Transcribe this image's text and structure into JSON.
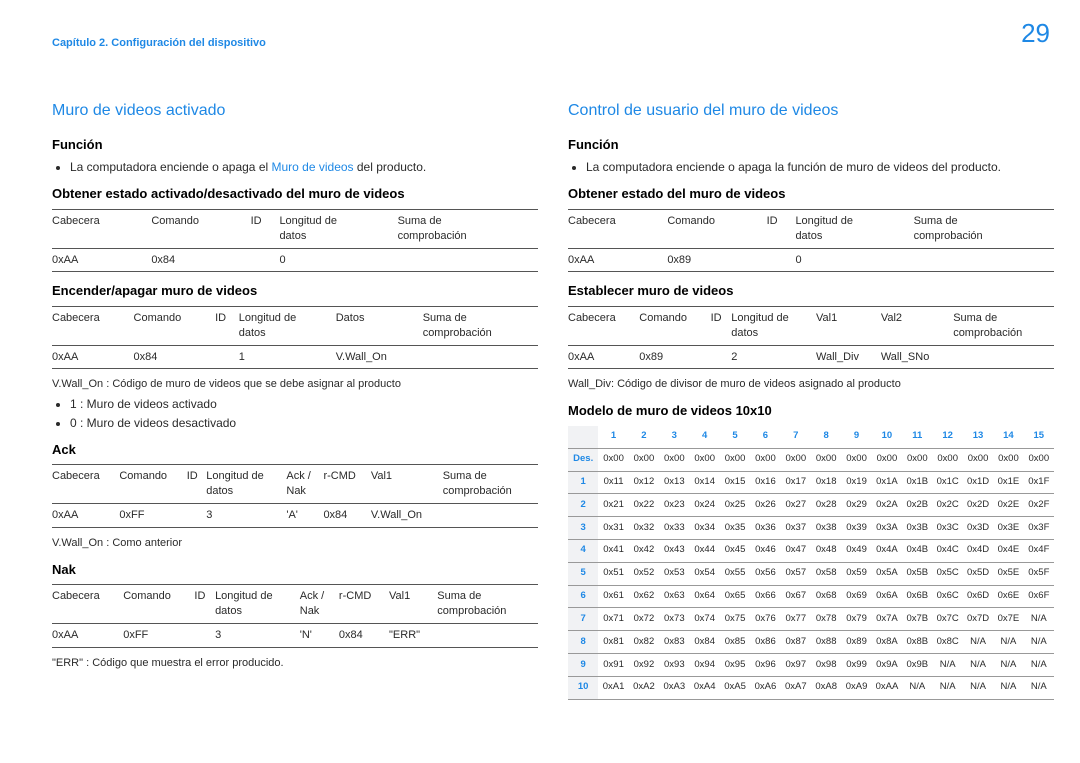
{
  "breadcrumb": "Capítulo 2. Configuración del dispositivo",
  "page_number": "29",
  "left": {
    "h_blue": "Muro de videos activado",
    "h_funcion": "Función",
    "funcion_bullet_pre": "La computadora enciende o apaga el ",
    "funcion_bullet_link": "Muro de videos",
    "funcion_bullet_post": " del producto.",
    "h_get": "Obtener estado activado/desactivado del muro de videos",
    "tbl_simple_cols": [
      "Cabecera",
      "Comando",
      "ID",
      "Longitud de datos",
      "Suma de comprobación"
    ],
    "tbl_get_row": [
      "0xAA",
      "0x84",
      "",
      "0",
      ""
    ],
    "h_set": "Encender/apagar muro de videos",
    "tbl_set_cols": [
      "Cabecera",
      "Comando",
      "ID",
      "Longitud de datos",
      "Datos",
      "Suma de comprobación"
    ],
    "tbl_set_row": [
      "0xAA",
      "0x84",
      "",
      "1",
      "V.Wall_On",
      ""
    ],
    "note_vwallon": "V.Wall_On : Código de muro de videos que se debe asignar al producto",
    "note_1": "1 : Muro de videos activado",
    "note_0": "0 : Muro de videos desactivado",
    "h_ack": "Ack",
    "tbl_ack_cols": [
      "Cabecera",
      "Comando",
      "ID",
      "Longitud de datos",
      "Ack / Nak",
      "r-CMD",
      "Val1",
      "Suma de comprobación"
    ],
    "tbl_ack_row": [
      "0xAA",
      "0xFF",
      "",
      "3",
      "'A'",
      "0x84",
      "V.Wall_On",
      ""
    ],
    "note_vwallon2": "V.Wall_On : Como anterior",
    "h_nak": "Nak",
    "tbl_nak_row": [
      "0xAA",
      "0xFF",
      "",
      "3",
      "'N'",
      "0x84",
      "\"ERR\"",
      ""
    ],
    "note_err": "\"ERR\" : Código que muestra el error producido."
  },
  "right": {
    "h_blue": "Control de usuario del muro de videos",
    "h_funcion": "Función",
    "funcion_bullet": "La computadora enciende o apaga la función de muro de videos del producto.",
    "h_get": "Obtener estado del muro de videos",
    "tbl_get_row": [
      "0xAA",
      "0x89",
      "",
      "0",
      ""
    ],
    "h_set": "Establecer muro de videos",
    "tbl_set_cols": [
      "Cabecera",
      "Comando",
      "ID",
      "Longitud de datos",
      "Val1",
      "Val2",
      "Suma de comprobación"
    ],
    "tbl_set_row": [
      "0xAA",
      "0x89",
      "",
      "2",
      "Wall_Div",
      "Wall_SNo",
      ""
    ],
    "note_walldiv": "Wall_Div: Código de divisor de muro de videos asignado al producto",
    "h_model": "Modelo de muro de videos 10x10",
    "hex_cols": [
      "",
      "1",
      "2",
      "3",
      "4",
      "5",
      "6",
      "7",
      "8",
      "9",
      "10",
      "11",
      "12",
      "13",
      "14",
      "15"
    ],
    "hex_rows": [
      {
        "lbl": "Des.",
        "v": [
          "0x00",
          "0x00",
          "0x00",
          "0x00",
          "0x00",
          "0x00",
          "0x00",
          "0x00",
          "0x00",
          "0x00",
          "0x00",
          "0x00",
          "0x00",
          "0x00",
          "0x00"
        ]
      },
      {
        "lbl": "1",
        "v": [
          "0x11",
          "0x12",
          "0x13",
          "0x14",
          "0x15",
          "0x16",
          "0x17",
          "0x18",
          "0x19",
          "0x1A",
          "0x1B",
          "0x1C",
          "0x1D",
          "0x1E",
          "0x1F"
        ]
      },
      {
        "lbl": "2",
        "v": [
          "0x21",
          "0x22",
          "0x23",
          "0x24",
          "0x25",
          "0x26",
          "0x27",
          "0x28",
          "0x29",
          "0x2A",
          "0x2B",
          "0x2C",
          "0x2D",
          "0x2E",
          "0x2F"
        ]
      },
      {
        "lbl": "3",
        "v": [
          "0x31",
          "0x32",
          "0x33",
          "0x34",
          "0x35",
          "0x36",
          "0x37",
          "0x38",
          "0x39",
          "0x3A",
          "0x3B",
          "0x3C",
          "0x3D",
          "0x3E",
          "0x3F"
        ]
      },
      {
        "lbl": "4",
        "v": [
          "0x41",
          "0x42",
          "0x43",
          "0x44",
          "0x45",
          "0x46",
          "0x47",
          "0x48",
          "0x49",
          "0x4A",
          "0x4B",
          "0x4C",
          "0x4D",
          "0x4E",
          "0x4F"
        ]
      },
      {
        "lbl": "5",
        "v": [
          "0x51",
          "0x52",
          "0x53",
          "0x54",
          "0x55",
          "0x56",
          "0x57",
          "0x58",
          "0x59",
          "0x5A",
          "0x5B",
          "0x5C",
          "0x5D",
          "0x5E",
          "0x5F"
        ]
      },
      {
        "lbl": "6",
        "v": [
          "0x61",
          "0x62",
          "0x63",
          "0x64",
          "0x65",
          "0x66",
          "0x67",
          "0x68",
          "0x69",
          "0x6A",
          "0x6B",
          "0x6C",
          "0x6D",
          "0x6E",
          "0x6F"
        ]
      },
      {
        "lbl": "7",
        "v": [
          "0x71",
          "0x72",
          "0x73",
          "0x74",
          "0x75",
          "0x76",
          "0x77",
          "0x78",
          "0x79",
          "0x7A",
          "0x7B",
          "0x7C",
          "0x7D",
          "0x7E",
          "N/A"
        ]
      },
      {
        "lbl": "8",
        "v": [
          "0x81",
          "0x82",
          "0x83",
          "0x84",
          "0x85",
          "0x86",
          "0x87",
          "0x88",
          "0x89",
          "0x8A",
          "0x8B",
          "0x8C",
          "N/A",
          "N/A",
          "N/A"
        ]
      },
      {
        "lbl": "9",
        "v": [
          "0x91",
          "0x92",
          "0x93",
          "0x94",
          "0x95",
          "0x96",
          "0x97",
          "0x98",
          "0x99",
          "0x9A",
          "0x9B",
          "N/A",
          "N/A",
          "N/A",
          "N/A"
        ]
      },
      {
        "lbl": "10",
        "v": [
          "0xA1",
          "0xA2",
          "0xA3",
          "0xA4",
          "0xA5",
          "0xA6",
          "0xA7",
          "0xA8",
          "0xA9",
          "0xAA",
          "N/A",
          "N/A",
          "N/A",
          "N/A",
          "N/A"
        ]
      }
    ]
  }
}
